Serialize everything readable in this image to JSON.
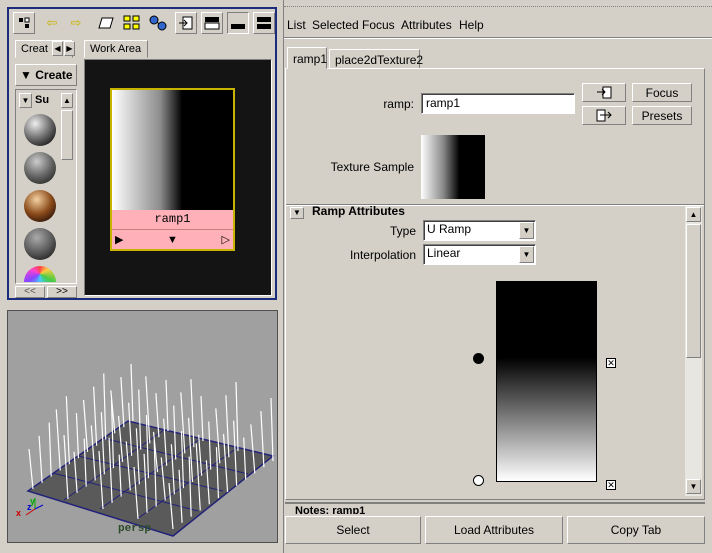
{
  "hypershade": {
    "tabs": {
      "create": "Creat",
      "work_area": "Work Area"
    },
    "create_menu": "Create",
    "list_header": "Su",
    "node": {
      "name": "ramp1"
    },
    "scroll_left": "<<",
    "scroll_right": ">>",
    "toolbar_icons": [
      "graph-icon",
      "arrow-left-icon",
      "arrow-right-icon",
      "eraser-icon",
      "grid-layout-icon",
      "network-icon",
      "import-icon",
      "layout-top-icon",
      "layout-bottom-icon",
      "layout-split-icon"
    ],
    "swatches": [
      "gray",
      "gray",
      "bronze",
      "gray",
      "rainbow"
    ]
  },
  "viewport": {
    "camera": "persp",
    "axis": {
      "x": "x",
      "y": "y",
      "z": "z"
    }
  },
  "attr_editor": {
    "menu": [
      "List",
      "Selected",
      "Focus",
      "Attributes",
      "Help"
    ],
    "tabs": [
      "ramp1",
      "place2dTexture2"
    ],
    "ramp_label": "ramp:",
    "ramp_value": "ramp1",
    "focus_button": "Focus",
    "presets_button": "Presets",
    "texture_sample_label": "Texture Sample",
    "section_title": "Ramp Attributes",
    "type_label": "Type",
    "type_value": "U Ramp",
    "interpolation_label": "Interpolation",
    "interpolation_value": "Linear",
    "notes_label": "Notes: ramp1",
    "bottom_buttons": {
      "select": "Select",
      "load": "Load Attributes",
      "copy": "Copy Tab"
    }
  },
  "colors": {
    "accent": "#1c2c7c",
    "node_label_bg": "#ffb0b8",
    "node_border": "#c8b400",
    "ramp_top": "#000000",
    "ramp_bottom": "#ffffff"
  }
}
